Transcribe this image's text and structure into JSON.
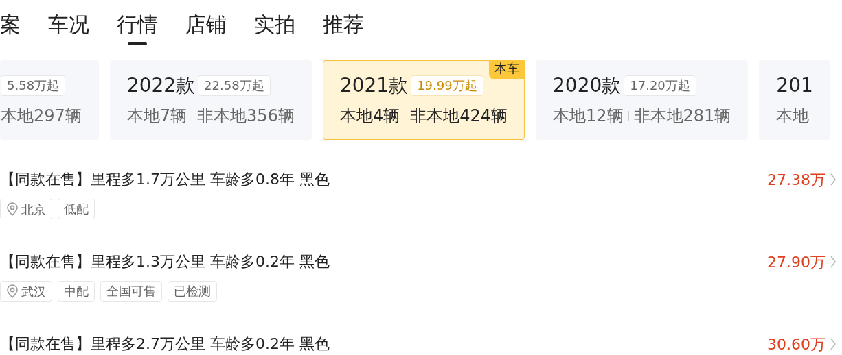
{
  "tabs": [
    {
      "label": "案",
      "selected": false
    },
    {
      "label": "车况",
      "selected": false
    },
    {
      "label": "行情",
      "selected": true
    },
    {
      "label": "店铺",
      "selected": false
    },
    {
      "label": "实拍",
      "selected": false
    },
    {
      "label": "推荐",
      "selected": false
    }
  ],
  "model_years": [
    {
      "price": "5.58万起",
      "nonlocal": "本地297辆",
      "selected": false
    },
    {
      "year": "2022款",
      "price": "22.58万起",
      "local": "本地7辆",
      "nonlocal": "非本地356辆",
      "selected": false
    },
    {
      "year": "2021款",
      "price": "19.99万起",
      "local": "本地4辆",
      "nonlocal": "非本地424辆",
      "selected": true,
      "badge": "本车"
    },
    {
      "year": "2020款",
      "price": "17.20万起",
      "local": "本地12辆",
      "nonlocal": "非本地281辆",
      "selected": false
    },
    {
      "year": "201",
      "local": "本地",
      "selected": false
    }
  ],
  "listings": [
    {
      "title": "【同款在售】里程多1.7万公里 车龄多0.8年 黑色",
      "price": "27.38万",
      "city": "北京",
      "tags": [
        "低配"
      ]
    },
    {
      "title": "【同款在售】里程多1.3万公里 车龄多0.2年 黑色",
      "price": "27.90万",
      "city": "武汉",
      "tags": [
        "中配",
        "全国可售",
        "已检测"
      ]
    },
    {
      "title": "【同款在售】里程多2.7万公里 车龄多0.2年 黑色",
      "price": "30.60万"
    }
  ]
}
